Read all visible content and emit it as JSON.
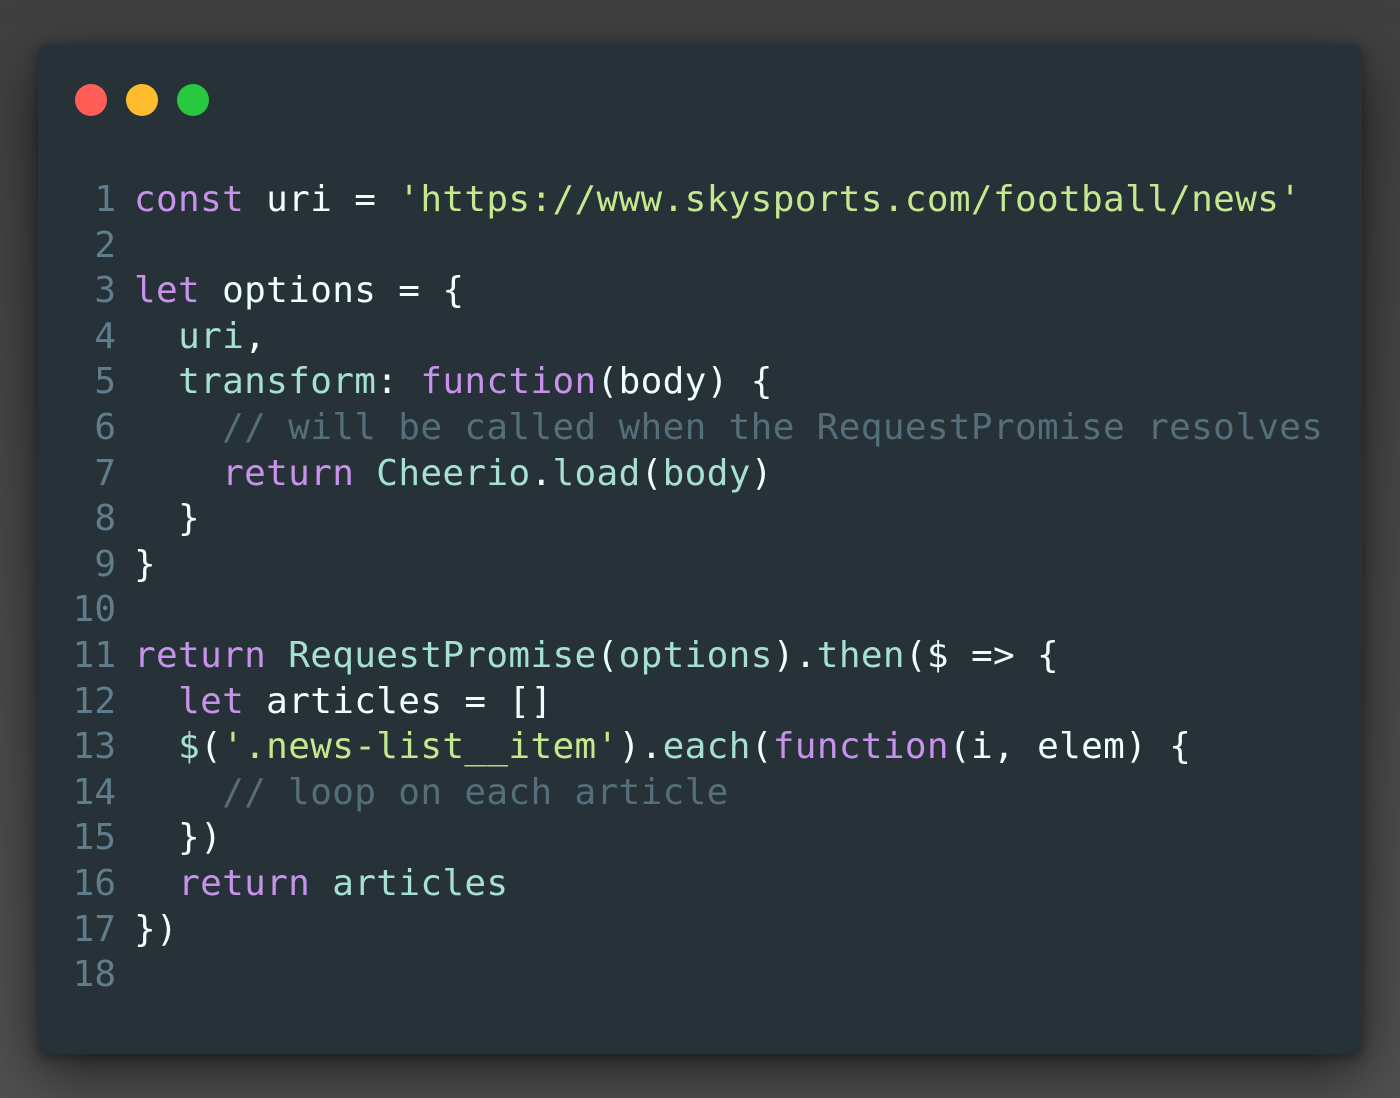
{
  "window": {
    "controls": {
      "close": {
        "color": "#ff5f56",
        "icon": "close-dot"
      },
      "minimize": {
        "color": "#ffbd2e",
        "icon": "minimize-dot"
      },
      "zoom": {
        "color": "#27c93f",
        "icon": "zoom-dot"
      }
    }
  },
  "colors": {
    "background": "#263238",
    "keyword": "#c792ea",
    "string": "#c3e88d",
    "comment": "#546e7a",
    "line_number": "#607d8b"
  },
  "code": {
    "lines": [
      {
        "n": "1",
        "tokens": [
          {
            "t": "const",
            "c": "kw"
          },
          {
            "t": " uri = ",
            "c": "id"
          },
          {
            "t": "'https://www.skysports.com/football/news'",
            "c": "str"
          }
        ]
      },
      {
        "n": "2",
        "tokens": []
      },
      {
        "n": "3",
        "tokens": [
          {
            "t": "let",
            "c": "kw"
          },
          {
            "t": " options = {",
            "c": "id"
          }
        ]
      },
      {
        "n": "4",
        "tokens": [
          {
            "t": "  ",
            "c": "id"
          },
          {
            "t": "uri",
            "c": "cls"
          },
          {
            "t": ",",
            "c": "id"
          }
        ]
      },
      {
        "n": "5",
        "tokens": [
          {
            "t": "  ",
            "c": "id"
          },
          {
            "t": "transform",
            "c": "cls"
          },
          {
            "t": ": ",
            "c": "id"
          },
          {
            "t": "function",
            "c": "kw"
          },
          {
            "t": "(body) {",
            "c": "id"
          }
        ]
      },
      {
        "n": "6",
        "tokens": [
          {
            "t": "    ",
            "c": "id"
          },
          {
            "t": "// will be called when the RequestPromise resolves",
            "c": "com"
          }
        ]
      },
      {
        "n": "7",
        "tokens": [
          {
            "t": "    ",
            "c": "id"
          },
          {
            "t": "return",
            "c": "kw"
          },
          {
            "t": " ",
            "c": "id"
          },
          {
            "t": "Cheerio",
            "c": "cls"
          },
          {
            "t": ".",
            "c": "id"
          },
          {
            "t": "load",
            "c": "cls"
          },
          {
            "t": "(",
            "c": "id"
          },
          {
            "t": "body",
            "c": "cls"
          },
          {
            "t": ")",
            "c": "id"
          }
        ]
      },
      {
        "n": "8",
        "tokens": [
          {
            "t": "  }",
            "c": "id"
          }
        ]
      },
      {
        "n": "9",
        "tokens": [
          {
            "t": "}",
            "c": "id"
          }
        ]
      },
      {
        "n": "10",
        "tokens": []
      },
      {
        "n": "11",
        "tokens": [
          {
            "t": "return",
            "c": "kw"
          },
          {
            "t": " ",
            "c": "id"
          },
          {
            "t": "RequestPromise",
            "c": "cls"
          },
          {
            "t": "(",
            "c": "id"
          },
          {
            "t": "options",
            "c": "cls"
          },
          {
            "t": ").",
            "c": "id"
          },
          {
            "t": "then",
            "c": "cls"
          },
          {
            "t": "($ => {",
            "c": "id"
          }
        ]
      },
      {
        "n": "12",
        "tokens": [
          {
            "t": "  ",
            "c": "id"
          },
          {
            "t": "let",
            "c": "kw"
          },
          {
            "t": " articles = []",
            "c": "id"
          }
        ]
      },
      {
        "n": "13",
        "tokens": [
          {
            "t": "  ",
            "c": "id"
          },
          {
            "t": "$",
            "c": "cls"
          },
          {
            "t": "(",
            "c": "id"
          },
          {
            "t": "'.news-list__item'",
            "c": "str"
          },
          {
            "t": ").",
            "c": "id"
          },
          {
            "t": "each",
            "c": "cls"
          },
          {
            "t": "(",
            "c": "id"
          },
          {
            "t": "function",
            "c": "kw"
          },
          {
            "t": "(i, elem) {",
            "c": "id"
          }
        ]
      },
      {
        "n": "14",
        "tokens": [
          {
            "t": "    ",
            "c": "id"
          },
          {
            "t": "// loop on each article",
            "c": "com"
          }
        ]
      },
      {
        "n": "15",
        "tokens": [
          {
            "t": "  })",
            "c": "id"
          }
        ]
      },
      {
        "n": "16",
        "tokens": [
          {
            "t": "  ",
            "c": "id"
          },
          {
            "t": "return",
            "c": "kw"
          },
          {
            "t": " ",
            "c": "id"
          },
          {
            "t": "articles",
            "c": "cls"
          }
        ]
      },
      {
        "n": "17",
        "tokens": [
          {
            "t": "})",
            "c": "id"
          }
        ]
      },
      {
        "n": "18",
        "tokens": []
      }
    ]
  }
}
